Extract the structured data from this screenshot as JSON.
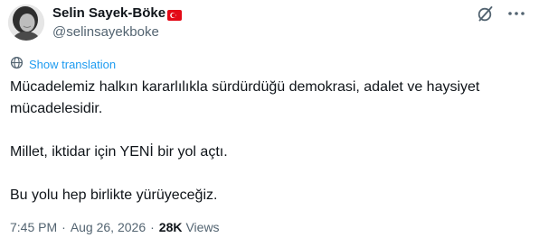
{
  "author": {
    "display_name": "Selin Sayek-Böke",
    "handle": "@selinsayekboke",
    "flag_icon": "turkey-flag-icon"
  },
  "actions": {
    "grok_icon": "grok-slash-circle-icon",
    "more_icon": "more-dots-icon"
  },
  "translation": {
    "icon": "translate-globe-icon",
    "label": "Show translation"
  },
  "tweet": {
    "paragraph_1": "Mücadelemiz halkın kararlılıkla sürdürdüğü demokrasi, adalet ve haysiyet mücadelesidir.",
    "paragraph_2": "Millet, iktidar için YENİ bir yol açtı.",
    "paragraph_3": "Bu yolu hep birlikte yürüyeceğiz."
  },
  "meta": {
    "time": "7:45 PM",
    "separator": "·",
    "date": "Aug 26, 2026",
    "views_count": "28K",
    "views_label": "Views"
  },
  "colors": {
    "text_primary": "#0f1419",
    "text_secondary": "#536471",
    "link_blue": "#1d9bf0",
    "flag_red": "#e30a17"
  }
}
